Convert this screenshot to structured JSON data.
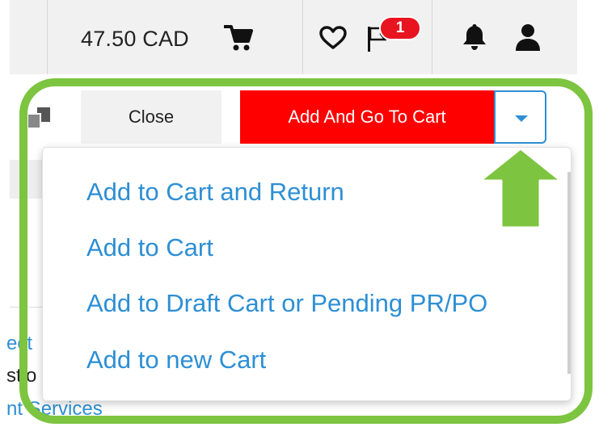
{
  "header": {
    "cart_total": "47.50 CAD",
    "notification_count": "1",
    "icons": [
      "cart-icon",
      "heart-icon",
      "flag-icon",
      "bell-icon",
      "user-icon"
    ]
  },
  "background": {
    "link_fragment": "ect",
    "text_fragment": "stio",
    "link_fragment_2": "nt Services"
  },
  "actions": {
    "close_label": "Close",
    "add_go_label": "Add And Go To Cart"
  },
  "dropdown": {
    "items": [
      {
        "label": "Add to Cart and Return"
      },
      {
        "label": "Add to Cart"
      },
      {
        "label": "Add to Draft Cart or Pending PR/PO"
      },
      {
        "label": "Add to new Cart"
      }
    ]
  },
  "colors": {
    "primary_red": "#ff0000",
    "link_blue": "#2d8fd4",
    "badge_red": "#e8141f",
    "annotation_green": "#7dc440",
    "header_gray": "#f1f1f1"
  }
}
